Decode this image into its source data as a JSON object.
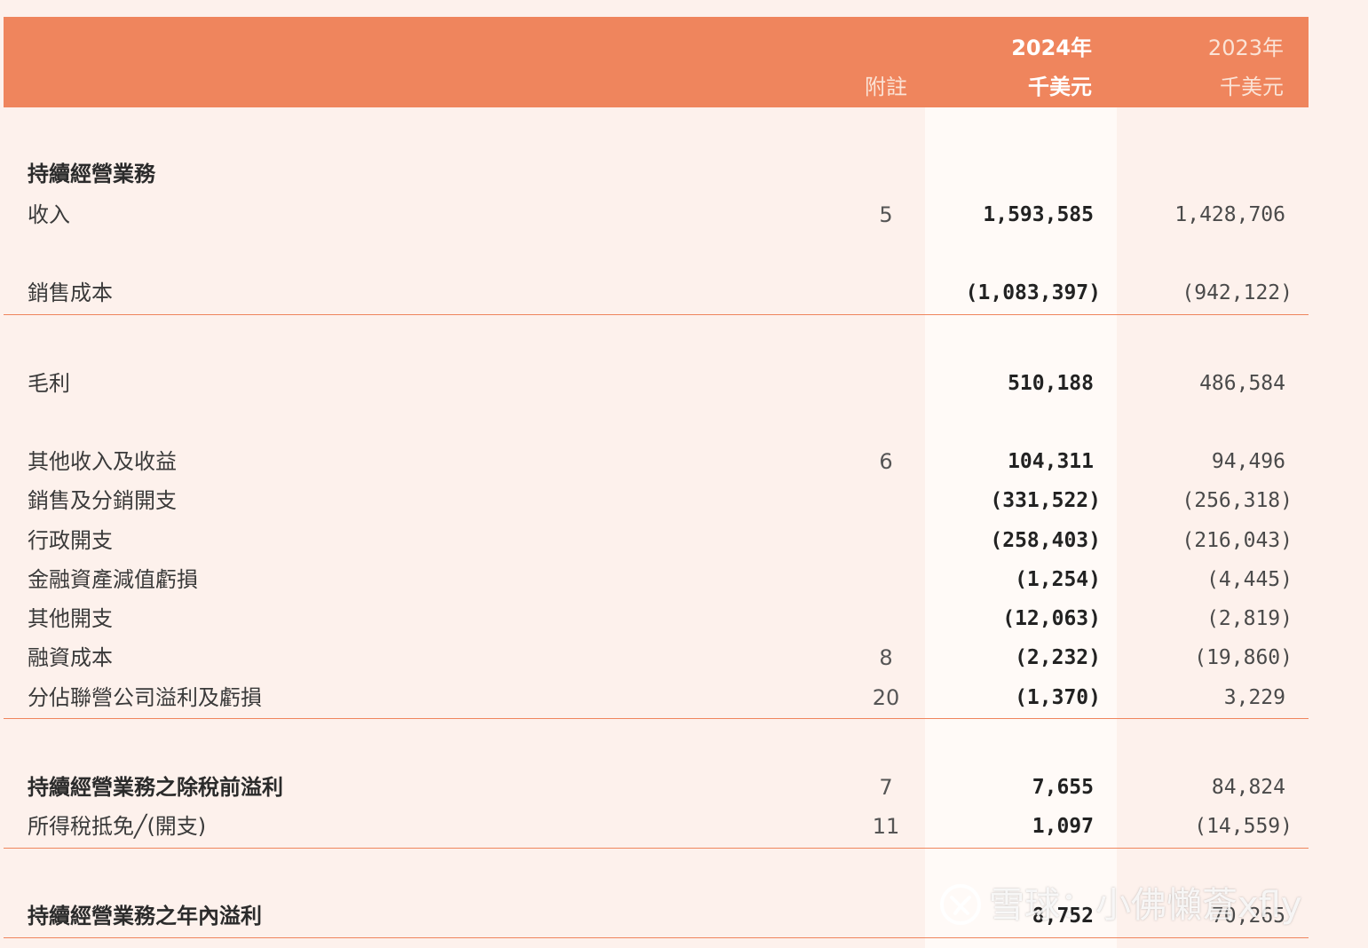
{
  "header": {
    "note_label": "附註",
    "current_year": "2024年",
    "current_unit": "千美元",
    "prior_year": "2023年",
    "prior_unit": "千美元"
  },
  "rows": [
    {
      "label": "持續經營業務",
      "note": "",
      "current": "",
      "prior": "",
      "bold": true
    },
    {
      "label": "收入",
      "note": "5",
      "current": "1,593,585",
      "prior": "1,428,706"
    },
    {
      "label": "銷售成本",
      "note": "",
      "current": "(1,083,397)",
      "prior": "(942,122)"
    },
    {
      "label": "毛利",
      "note": "",
      "current": "510,188",
      "prior": "486,584"
    },
    {
      "label": "其他收入及收益",
      "note": "6",
      "current": "104,311",
      "prior": "94,496"
    },
    {
      "label": "銷售及分銷開支",
      "note": "",
      "current": "(331,522)",
      "prior": "(256,318)"
    },
    {
      "label": "行政開支",
      "note": "",
      "current": "(258,403)",
      "prior": "(216,043)"
    },
    {
      "label": "金融資產減值虧損",
      "note": "",
      "current": "(1,254)",
      "prior": "(4,445)"
    },
    {
      "label": "其他開支",
      "note": "",
      "current": "(12,063)",
      "prior": "(2,819)"
    },
    {
      "label": "融資成本",
      "note": "8",
      "current": "(2,232)",
      "prior": "(19,860)"
    },
    {
      "label": "分佔聯營公司溢利及虧損",
      "note": "20",
      "current": "(1,370)",
      "prior": "3,229"
    },
    {
      "label": "持續經營業務之除稅前溢利",
      "note": "7",
      "current": "7,655",
      "prior": "84,824",
      "bold": true
    },
    {
      "label": "所得稅抵免╱(開支)",
      "note": "11",
      "current": "1,097",
      "prior": "(14,559)"
    },
    {
      "label": "持續經營業務之年內溢利",
      "note": "",
      "current": "8,752",
      "prior": "70,265",
      "bold": true
    }
  ],
  "watermark": {
    "text": "雪球：小佛懶蒼xfly"
  },
  "colors": {
    "header_bg": "#ef855d",
    "page_bg": "#fdf1ec",
    "highlight_col": "#fffaf7",
    "rule": "#ef855d"
  }
}
